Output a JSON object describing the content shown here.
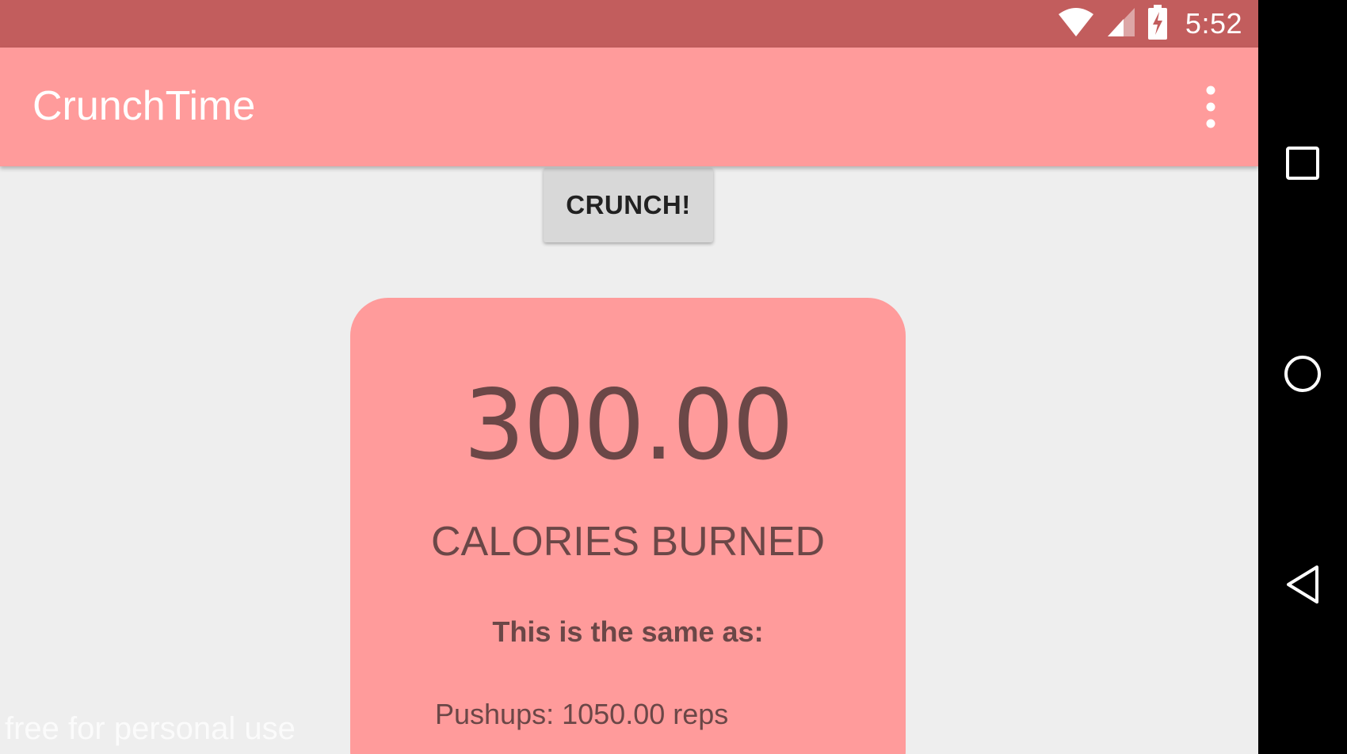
{
  "status_bar": {
    "time": "5:52",
    "icons": [
      "wifi-icon",
      "cell-signal-icon",
      "battery-charging-icon"
    ]
  },
  "app_bar": {
    "title": "CrunchTime",
    "overflow_icon": "more-vert-icon"
  },
  "main": {
    "crunch_button_label": "CRUNCH!",
    "card": {
      "calories_value": "300.00",
      "calories_label": "CALORIES BURNED",
      "same_as_label": "This is the same as:",
      "pushups_line": "Pushups: 1050.00 reps"
    }
  },
  "watermark": "free for personal use",
  "nav_bar": {
    "icons": [
      "recents-icon",
      "home-icon",
      "back-icon"
    ]
  },
  "colors": {
    "status_bar": "#c25d5d",
    "primary": "#ff9b9b",
    "background": "#eeeeee",
    "card_text": "#6b4747",
    "nav_bar": "#000000"
  }
}
